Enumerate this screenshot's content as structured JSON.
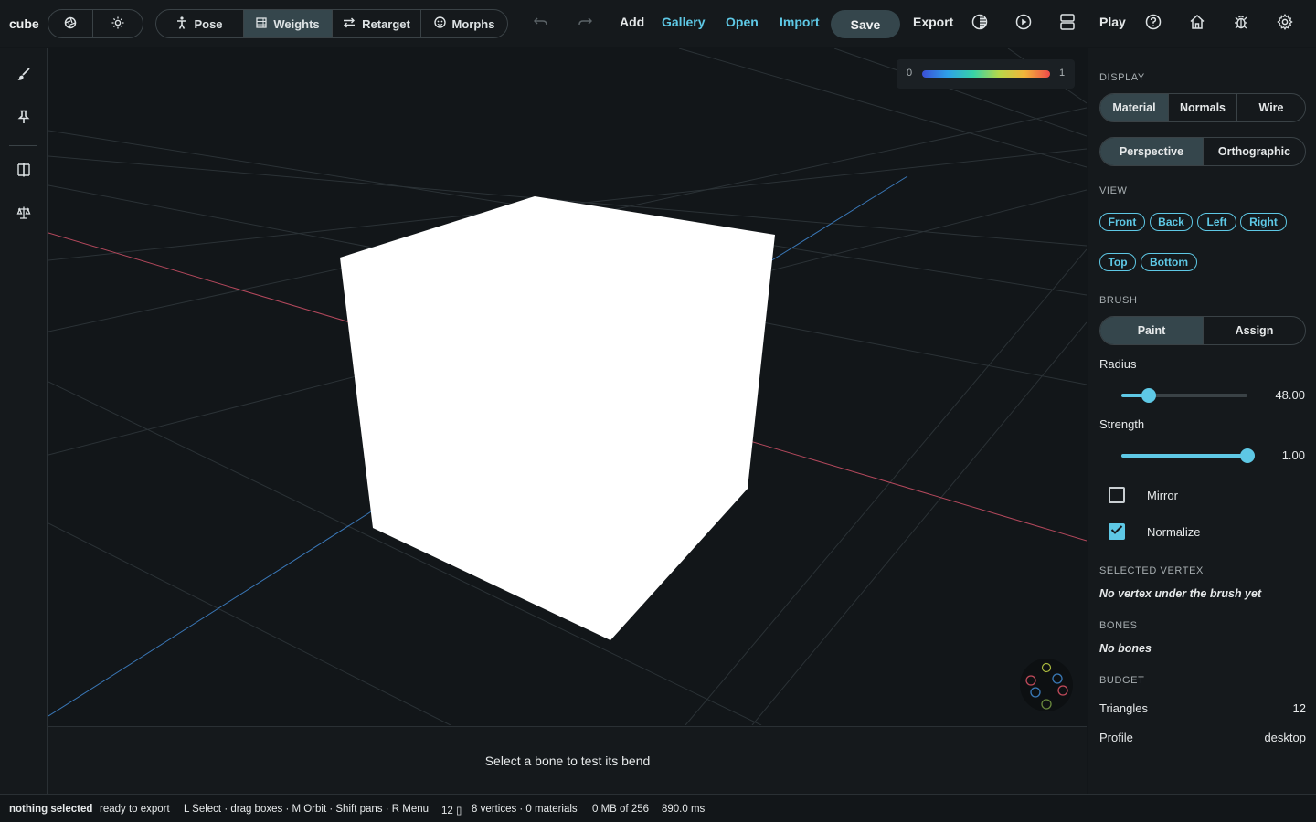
{
  "app": {
    "title": "cube"
  },
  "toolbar": {
    "modes": [
      {
        "label": "Pose",
        "icon": "figure-icon",
        "active": false
      },
      {
        "label": "Weights",
        "icon": "grid-icon",
        "active": true
      },
      {
        "label": "Retarget",
        "icon": "swap-icon",
        "active": false
      },
      {
        "label": "Morphs",
        "icon": "face-icon",
        "active": false
      }
    ],
    "add": "Add",
    "gallery": "Gallery",
    "open": "Open",
    "import": "Import",
    "save": "Save",
    "export": "Export",
    "play": "Play"
  },
  "viewport": {
    "legend_min": "0",
    "legend_max": "1",
    "hint": "Select a bone to test its bend"
  },
  "panel": {
    "display_title": "DISPLAY",
    "display_modes": [
      "Material",
      "Normals",
      "Wire"
    ],
    "display_active": "Material",
    "projections": [
      "Perspective",
      "Orthographic"
    ],
    "projection_active": "Perspective",
    "view_title": "VIEW",
    "views": [
      "Front",
      "Back",
      "Left",
      "Right",
      "Top",
      "Bottom"
    ],
    "brush_title": "BRUSH",
    "brush_modes": [
      "Paint",
      "Assign"
    ],
    "brush_active": "Paint",
    "radius_label": "Radius",
    "radius_value": "48.00",
    "radius_fraction": 0.22,
    "strength_label": "Strength",
    "strength_value": "1.00",
    "strength_fraction": 1.0,
    "mirror_label": "Mirror",
    "mirror_checked": false,
    "normalize_label": "Normalize",
    "normalize_checked": true,
    "selected_vertex_title": "SELECTED VERTEX",
    "selected_vertex_text": "No vertex under the brush yet",
    "bones_title": "BONES",
    "bones_text": "No bones",
    "budget_title": "BUDGET",
    "triangles_label": "Triangles",
    "triangles_value": "12",
    "profile_label": "Profile",
    "profile_value": "desktop"
  },
  "status": {
    "selection": "nothing selected",
    "export_state": "ready to export",
    "shortcuts": "L Select · drag boxes · M Orbit · Shift pans · R Menu",
    "count": "12 ▯",
    "mesh": "8 vertices · 0 materials",
    "memory": "0 MB of 256",
    "time": "890.0 ms"
  },
  "colors": {
    "accent": "#5ec8e5",
    "active_bg": "#35464c",
    "bg": "#121619",
    "x_axis": "#c24a5e",
    "z_axis": "#3a78b8"
  }
}
